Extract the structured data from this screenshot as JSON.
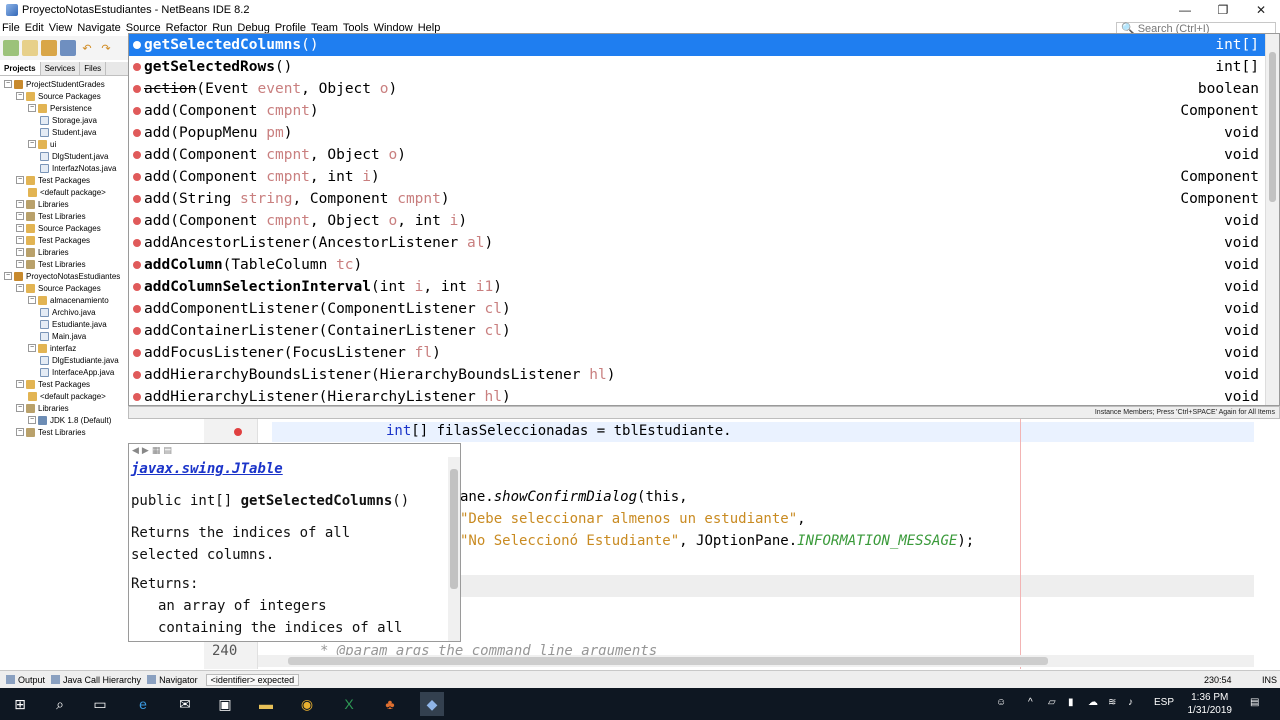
{
  "window": {
    "title": "ProyectoNotasEstudiantes - NetBeans IDE 8.2",
    "controls": [
      "—",
      "❐",
      "✕"
    ]
  },
  "menu": [
    "File",
    "Edit",
    "View",
    "Navigate",
    "Source",
    "Refactor",
    "Run",
    "Debug",
    "Profile",
    "Team",
    "Tools",
    "Window",
    "Help"
  ],
  "search": {
    "placeholder": "Search (Ctrl+I)"
  },
  "projects_panel": {
    "tabs": [
      "Projects",
      "Services",
      "Files"
    ],
    "tree": [
      {
        "label": "ProjectStudentGrades",
        "icon": "project-icon"
      },
      {
        "label": "Source Packages",
        "icon": "package-icon"
      },
      {
        "label": "Persistence",
        "icon": "package-icon"
      },
      {
        "label": "Storage.java",
        "icon": "java-file-icon"
      },
      {
        "label": "Student.java",
        "icon": "java-file-icon"
      },
      {
        "label": "ui",
        "icon": "package-icon"
      },
      {
        "label": "DlgStudent.java",
        "icon": "java-file-icon"
      },
      {
        "label": "InterfazNotas.java",
        "icon": "java-file-icon"
      },
      {
        "label": "Test Packages",
        "icon": "package-icon"
      },
      {
        "label": "<default package>",
        "icon": "package-icon"
      },
      {
        "label": "Libraries",
        "icon": "library-icon"
      },
      {
        "label": "Test Libraries",
        "icon": "library-icon"
      },
      {
        "label": "Source Packages",
        "icon": "package-icon"
      },
      {
        "label": "Test Packages",
        "icon": "package-icon"
      },
      {
        "label": "Libraries",
        "icon": "library-icon"
      },
      {
        "label": "Test Libraries",
        "icon": "library-icon"
      },
      {
        "label": "ProyectoNotasEstudiantes",
        "icon": "project-icon"
      },
      {
        "label": "Source Packages",
        "icon": "package-icon"
      },
      {
        "label": "almacenamiento",
        "icon": "package-icon"
      },
      {
        "label": "Archivo.java",
        "icon": "java-file-icon"
      },
      {
        "label": "Estudiante.java",
        "icon": "java-file-icon"
      },
      {
        "label": "Main.java",
        "icon": "java-file-icon"
      },
      {
        "label": "interfaz",
        "icon": "package-icon"
      },
      {
        "label": "DlgEstudiante.java",
        "icon": "java-file-icon"
      },
      {
        "label": "InterfaceApp.java",
        "icon": "java-file-icon"
      },
      {
        "label": "Test Packages",
        "icon": "package-icon"
      },
      {
        "label": "<default package>",
        "icon": "package-icon"
      },
      {
        "label": "Libraries",
        "icon": "library-icon"
      },
      {
        "label": "JDK 1.8 (Default)",
        "icon": "jdk-icon"
      },
      {
        "label": "Test Libraries",
        "icon": "library-icon"
      }
    ]
  },
  "completion": {
    "items": [
      {
        "name": "getSelectedColumns",
        "params": "()",
        "ret": "int[]"
      },
      {
        "name": "getSelectedRows",
        "params": "()",
        "ret": "int[]"
      },
      {
        "name": "action",
        "params": "(Event event, Object o)",
        "ret": "boolean"
      },
      {
        "name": "add",
        "params": "(Component cmpnt)",
        "ret": "Component"
      },
      {
        "name": "add",
        "params": "(PopupMenu pm)",
        "ret": "void"
      },
      {
        "name": "add",
        "params": "(Component cmpnt, Object o)",
        "ret": "void"
      },
      {
        "name": "add",
        "params": "(Component cmpnt, int i)",
        "ret": "Component"
      },
      {
        "name": "add",
        "params": "(String string, Component cmpnt)",
        "ret": "Component"
      },
      {
        "name": "add",
        "params": "(Component cmpnt, Object o, int i)",
        "ret": "void"
      },
      {
        "name": "addAncestorListener",
        "params": "(AncestorListener al)",
        "ret": "void"
      },
      {
        "name": "addColumn",
        "params": "(TableColumn tc)",
        "ret": "void"
      },
      {
        "name": "addColumnSelectionInterval",
        "params": "(int i, int i1)",
        "ret": "void"
      },
      {
        "name": "addComponentListener",
        "params": "(ComponentListener cl)",
        "ret": "void"
      },
      {
        "name": "addContainerListener",
        "params": "(ContainerListener cl)",
        "ret": "void"
      },
      {
        "name": "addFocusListener",
        "params": "(FocusListener fl)",
        "ret": "void"
      },
      {
        "name": "addHierarchyBoundsListener",
        "params": "(HierarchyBoundsListener hl)",
        "ret": "void"
      },
      {
        "name": "addHierarchyListener",
        "params": "(HierarchyListener hl)",
        "ret": "void"
      }
    ],
    "status": "Instance Members; Press 'Ctrl+SPACE' Again for All Items"
  },
  "editor": {
    "current_line": "int[] filasSeleccionadas = tblEstudiante.",
    "line_a_prefix": "ane.",
    "line_a_method": "showConfirmDialog",
    "line_a_rest": "(this,",
    "line_b": "\"Debe seleccionar almenos un estudiante\"",
    "line_b_end": ",",
    "line_c": "\"No Seleccionó Estudiante\"",
    "line_c_mid": ", JOptionPane.",
    "line_c_const": "INFORMATION_MESSAGE",
    "line_c_end": ");",
    "line_number": "240",
    "comment_line": "* @param args the command line arguments"
  },
  "javadoc": {
    "class": "javax.swing.JTable",
    "signature_prefix": "public int[] ",
    "signature_name": "getSelectedColumns",
    "signature_suffix": "()",
    "desc_line1": "Returns the indices of all",
    "desc_line2": "selected columns.",
    "returns_label": "Returns:",
    "returns_line1": "an array of integers",
    "returns_line2": "containing the indices of all"
  },
  "statusbar": {
    "output": "Output",
    "call_hierarchy": "Java Call Hierarchy",
    "navigator": "Navigator",
    "message": "<identifier> expected",
    "position": "230:54",
    "mode": "INS"
  },
  "taskbar": {
    "time": "1:36 PM",
    "date": "1/31/2019",
    "lang": "ESP"
  },
  "colors": {
    "selection": "#1f7ef0",
    "keyword": "#1b34c9",
    "string": "#c98b22",
    "constant": "#3a9a3a"
  }
}
